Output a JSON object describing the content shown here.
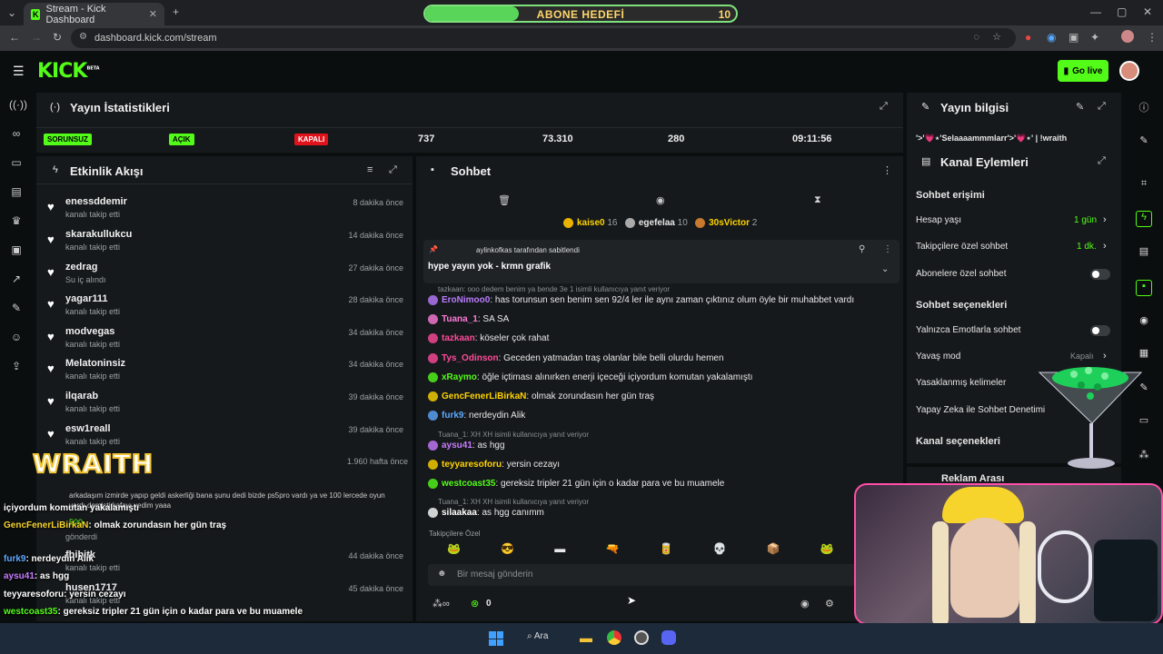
{
  "browser": {
    "tab_title": "Stream - Kick Dashboard",
    "url": "dashboard.kick.com/stream"
  },
  "goal": {
    "label": "ABONE HEDEFİ",
    "value": "10",
    "progress": 0.3
  },
  "header": {
    "logo": "KICK",
    "logo_sup": "BETA",
    "go_live": "Go live"
  },
  "stats": {
    "title": "Yayın İstatistikleri",
    "badges": [
      "SORUNSUZ",
      "AÇIK",
      "KAPALI"
    ],
    "values": [
      "737",
      "73.310",
      "280",
      "09:11:56"
    ]
  },
  "activity": {
    "title": "Etkinlik Akışı",
    "items": [
      {
        "name": "enessddemir",
        "sub": "kanalı takip etti",
        "time": "8 dakika önce"
      },
      {
        "name": "skarakullukcu",
        "sub": "kanalı takip etti",
        "time": "14 dakika önce"
      },
      {
        "name": "zedrag",
        "sub": "Su iç alındı",
        "time": "27 dakika önce"
      },
      {
        "name": "yagar111",
        "sub": "kanalı takip etti",
        "time": "28 dakika önce"
      },
      {
        "name": "modvegas",
        "sub": "kanalı takip etti",
        "time": "34 dakika önce"
      },
      {
        "name": "Melatoninsiz",
        "sub": "kanalı takip etti",
        "time": "34 dakika önce"
      },
      {
        "name": "ilqarab",
        "sub": "kanalı takip etti",
        "time": "39 dakika önce"
      },
      {
        "name": "esw1reall",
        "sub": "kanalı takip etti",
        "time": "39 dakika önce"
      }
    ],
    "extra_time": "1.960 hafta önce",
    "extra_text": "arkadaşım izmirde yapıp geldi askerliği bana şunu dedi bizde ps5pro vardı ya ve 100 lercede oyun vardı demişti kafayı yedim yaaa",
    "extra_count": "500",
    "extra_sent": "gönderdi",
    "late_items": [
      {
        "name": "fhihitk",
        "sub": "kanalı takip etti",
        "time": "44 dakika önce"
      },
      {
        "name": "husen1717",
        "sub": "kanalı takip etti",
        "time": "45 dakika önce"
      }
    ]
  },
  "chat": {
    "title": "Sohbet",
    "top_users": [
      {
        "name": "kaise0",
        "count": "16"
      },
      {
        "name": "egefelaa",
        "count": "10"
      },
      {
        "name": "30sVictor",
        "count": "2"
      }
    ],
    "pinned_by": "aylinkofkas tarafından sabitlendi",
    "pinned_text": "hype yayın yok - krmn grafik",
    "messages": [
      {
        "reply": "tazkaan: ooo dedem benim ya bende 3e 1 isimli kullanıcıya yanıt veriyor",
        "user": "EroNimoo0",
        "color": "#b97bff",
        "text": "has torunsun sen benim sen 92/4 ler ile aynı zaman çıktınız olum öyle bir muhabbet vardı"
      },
      {
        "user": "Tuana_1",
        "color": "#ff7ad9",
        "text": "SA SA"
      },
      {
        "user": "tazkaan",
        "color": "#ff4a9b",
        "text": "köseler çok rahat"
      },
      {
        "user": "Tys_Odinson",
        "color": "#ff4a9b",
        "text": "Geceden yatmadan traş olanlar bile belli olurdu hemen"
      },
      {
        "user": "xRaymo",
        "color": "#53fc18",
        "text": "öğle içtiması alınırken enerji içeceği içiyordum komutan yakalamıştı"
      },
      {
        "user": "GencFenerLiBirkaN",
        "color": "#ffd400",
        "text": "olmak zorundasın her gün traş"
      },
      {
        "user": "furk9",
        "color": "#5da8ff",
        "text": "nerdeydin Alik"
      },
      {
        "reply": "Tuana_1: XH XH isimli kullanıcıya yanıt veriyor",
        "user": "aysu41",
        "color": "#c87bff",
        "text": "as hgg"
      },
      {
        "user": "teyyaresoforu",
        "color": "#ffd400",
        "text": "yersin cezayı"
      },
      {
        "user": "westcoast35",
        "color": "#53fc18",
        "text": "gereksiz tripler 21 gün için o kadar para ve bu muamele"
      },
      {
        "reply": "Tuana_1: XH XH isimli kullanıcıya yanıt veriyor",
        "user": "silaakaa",
        "color": "#ffffff",
        "text": "as hgg canımm"
      }
    ],
    "followers_only": "Takipçilere Özel",
    "input_placeholder": "Bir mesaj gönderin",
    "points": "0"
  },
  "stream_info": {
    "title": "Yayın bilgisi",
    "stream_title": "'>'💗⋆'Selaaaammmlarr'>'💗⋆' | !wraith"
  },
  "channel_actions": {
    "title": "Kanal Eylemleri",
    "access_title": "Sohbet erişimi",
    "rows": [
      {
        "label": "Hesap yaşı",
        "value": "1 gün"
      },
      {
        "label": "Takipçilere özel sohbet",
        "value": "1 dk."
      },
      {
        "label": "Abonelere özel sohbet",
        "value": ""
      }
    ],
    "options_title": "Sohbet seçenekleri",
    "options": [
      {
        "label": "Yalnızca Emotlarla sohbet",
        "value": ""
      },
      {
        "label": "Yavaş mod",
        "value": "Kapalı"
      },
      {
        "label": "Yasaklanmış kelimeler",
        "value": ""
      },
      {
        "label": "Yapay Zeka ile Sohbet Denetimi",
        "value": ""
      }
    ],
    "channel_options": "Kanal seçenekleri",
    "ad_break": "Reklam Arası"
  },
  "overlay": {
    "wraith": "WRAITH",
    "lines": [
      {
        "user": "",
        "text": "içiyordum komutan yakalamıştı"
      },
      {
        "user": "GencFenerLiBirkaN",
        "text": ": olmak zorundasın her gün traş"
      },
      {
        "user": "furk9",
        "text": ": nerdeydin Alik"
      },
      {
        "user": "aysu41",
        "text": ": as hgg"
      },
      {
        "user": "teyyaresoforu",
        "text": ": yersin cezayı"
      },
      {
        "user": "westcoast35",
        "text": ": gereksiz tripler 21 gün için o kadar para ve bu muamele"
      },
      {
        "user": "silaakaa",
        "text": ": as hgg canımm"
      }
    ]
  },
  "taskbar": {
    "search": "Ara"
  }
}
